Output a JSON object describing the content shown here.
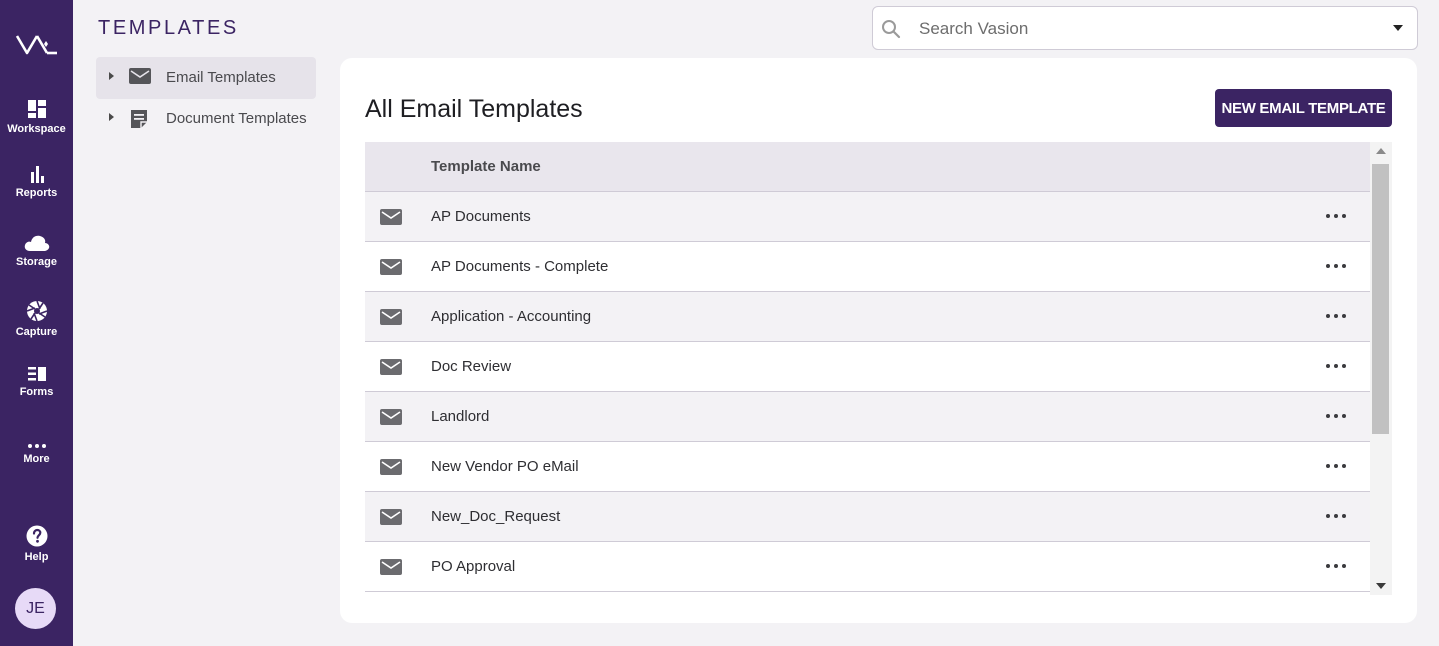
{
  "app": {
    "page_title": "TEMPLATES",
    "brand_color": "#3b2463"
  },
  "rail": {
    "logo_icon": "vasion-logo",
    "items": [
      {
        "label": "Workspace",
        "icon": "dashboard-icon"
      },
      {
        "label": "Reports",
        "icon": "bar-chart-icon"
      },
      {
        "label": "Storage",
        "icon": "cloud-icon"
      },
      {
        "label": "Capture",
        "icon": "aperture-icon"
      },
      {
        "label": "Forms",
        "icon": "forms-icon"
      },
      {
        "label": "More",
        "icon": "more-horizontal-icon"
      },
      {
        "label": "Help",
        "icon": "help-circle-icon"
      }
    ],
    "avatar_initials": "JE"
  },
  "search": {
    "placeholder": "Search Vasion",
    "value": ""
  },
  "tree": {
    "items": [
      {
        "label": "Email Templates",
        "icon": "mail-icon",
        "active": true
      },
      {
        "label": "Document Templates",
        "icon": "document-icon",
        "active": false
      }
    ]
  },
  "main": {
    "title": "All Email Templates",
    "new_button_label": "NEW EMAIL TEMPLATE",
    "table": {
      "column_header": "Template Name",
      "rows": [
        {
          "name": "AP Documents"
        },
        {
          "name": "AP Documents - Complete"
        },
        {
          "name": "Application - Accounting"
        },
        {
          "name": "Doc Review"
        },
        {
          "name": "Landlord"
        },
        {
          "name": "New Vendor PO eMail"
        },
        {
          "name": "New_Doc_Request"
        },
        {
          "name": "PO Approval"
        }
      ]
    }
  }
}
